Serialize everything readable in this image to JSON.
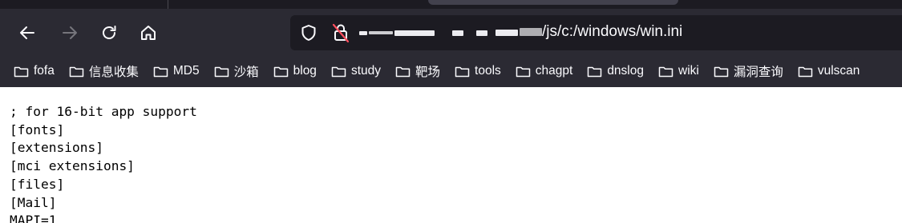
{
  "toolbar": {
    "back_icon": "arrow-left-icon",
    "forward_icon": "arrow-right-icon",
    "reload_icon": "reload-icon",
    "home_icon": "home-icon"
  },
  "urlbar": {
    "url_visible": "/js/c:/windows/win.ini",
    "security_icons": [
      "shield-icon",
      "lock-warning-icon"
    ],
    "url_host_redacted": true
  },
  "bookmarks": [
    {
      "label": "fofa"
    },
    {
      "label": "信息收集"
    },
    {
      "label": "MD5"
    },
    {
      "label": "沙箱"
    },
    {
      "label": "blog"
    },
    {
      "label": "study"
    },
    {
      "label": "靶场"
    },
    {
      "label": "tools"
    },
    {
      "label": "chagpt"
    },
    {
      "label": "dnslog"
    },
    {
      "label": "wiki"
    },
    {
      "label": "漏洞查询"
    },
    {
      "label": "vulscan"
    }
  ],
  "page": {
    "lines": [
      "; for 16-bit app support",
      "[fonts]",
      "[extensions]",
      "[mci extensions]",
      "[files]",
      "[Mail]",
      "MAPI=1"
    ]
  },
  "colors": {
    "toolbar_bg": "#2b2a33",
    "urlbar_bg": "#1c1b22",
    "chrome_text": "#fbfbfe",
    "page_bg": "#ffffff",
    "page_text": "#000000"
  }
}
